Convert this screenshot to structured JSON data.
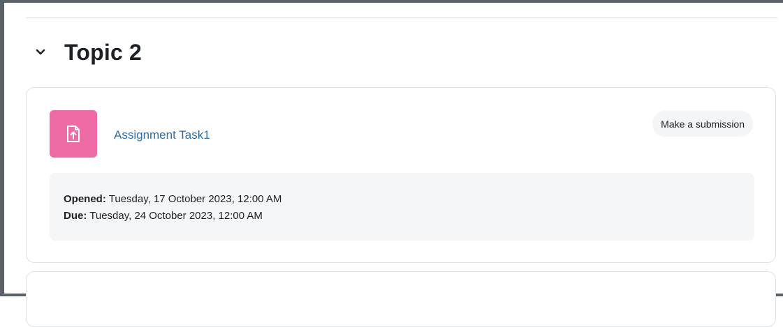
{
  "section": {
    "title": "Topic 2",
    "toggle_icon": "chevron-down-icon"
  },
  "activity": {
    "icon": "assignment-upload-icon",
    "icon_color": "#ef6ba6",
    "name": "Assignment Task1",
    "link_color": "#2f6ea5",
    "action_label": "Make a submission",
    "dates": {
      "opened_label": "Opened:",
      "opened_value": "Tuesday, 17 October 2023, 12:00 AM",
      "due_label": "Due:",
      "due_value": "Tuesday, 24 October 2023, 12:00 AM"
    }
  }
}
